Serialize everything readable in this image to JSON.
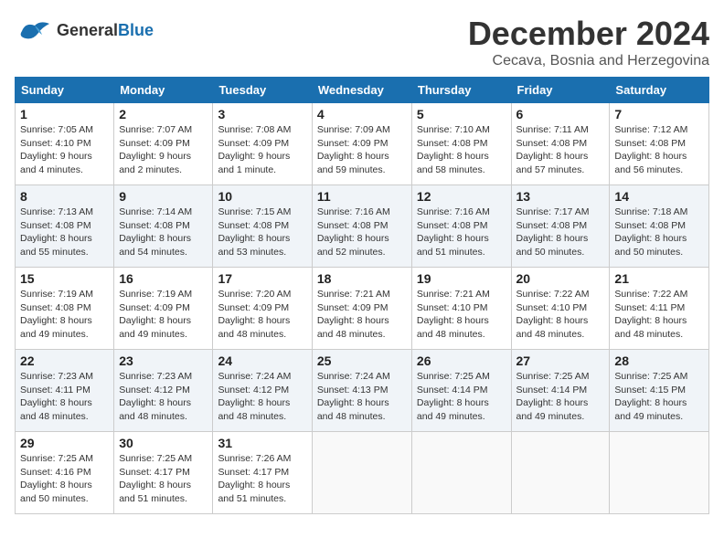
{
  "logo": {
    "general": "General",
    "blue": "Blue"
  },
  "title": "December 2024",
  "subtitle": "Cecava, Bosnia and Herzegovina",
  "headers": [
    "Sunday",
    "Monday",
    "Tuesday",
    "Wednesday",
    "Thursday",
    "Friday",
    "Saturday"
  ],
  "weeks": [
    [
      {
        "day": "1",
        "sunrise": "7:05 AM",
        "sunset": "4:10 PM",
        "daylight": "9 hours and 4 minutes."
      },
      {
        "day": "2",
        "sunrise": "7:07 AM",
        "sunset": "4:09 PM",
        "daylight": "9 hours and 2 minutes."
      },
      {
        "day": "3",
        "sunrise": "7:08 AM",
        "sunset": "4:09 PM",
        "daylight": "9 hours and 1 minute."
      },
      {
        "day": "4",
        "sunrise": "7:09 AM",
        "sunset": "4:09 PM",
        "daylight": "8 hours and 59 minutes."
      },
      {
        "day": "5",
        "sunrise": "7:10 AM",
        "sunset": "4:08 PM",
        "daylight": "8 hours and 58 minutes."
      },
      {
        "day": "6",
        "sunrise": "7:11 AM",
        "sunset": "4:08 PM",
        "daylight": "8 hours and 57 minutes."
      },
      {
        "day": "7",
        "sunrise": "7:12 AM",
        "sunset": "4:08 PM",
        "daylight": "8 hours and 56 minutes."
      }
    ],
    [
      {
        "day": "8",
        "sunrise": "7:13 AM",
        "sunset": "4:08 PM",
        "daylight": "8 hours and 55 minutes."
      },
      {
        "day": "9",
        "sunrise": "7:14 AM",
        "sunset": "4:08 PM",
        "daylight": "8 hours and 54 minutes."
      },
      {
        "day": "10",
        "sunrise": "7:15 AM",
        "sunset": "4:08 PM",
        "daylight": "8 hours and 53 minutes."
      },
      {
        "day": "11",
        "sunrise": "7:16 AM",
        "sunset": "4:08 PM",
        "daylight": "8 hours and 52 minutes."
      },
      {
        "day": "12",
        "sunrise": "7:16 AM",
        "sunset": "4:08 PM",
        "daylight": "8 hours and 51 minutes."
      },
      {
        "day": "13",
        "sunrise": "7:17 AM",
        "sunset": "4:08 PM",
        "daylight": "8 hours and 50 minutes."
      },
      {
        "day": "14",
        "sunrise": "7:18 AM",
        "sunset": "4:08 PM",
        "daylight": "8 hours and 50 minutes."
      }
    ],
    [
      {
        "day": "15",
        "sunrise": "7:19 AM",
        "sunset": "4:08 PM",
        "daylight": "8 hours and 49 minutes."
      },
      {
        "day": "16",
        "sunrise": "7:19 AM",
        "sunset": "4:09 PM",
        "daylight": "8 hours and 49 minutes."
      },
      {
        "day": "17",
        "sunrise": "7:20 AM",
        "sunset": "4:09 PM",
        "daylight": "8 hours and 48 minutes."
      },
      {
        "day": "18",
        "sunrise": "7:21 AM",
        "sunset": "4:09 PM",
        "daylight": "8 hours and 48 minutes."
      },
      {
        "day": "19",
        "sunrise": "7:21 AM",
        "sunset": "4:10 PM",
        "daylight": "8 hours and 48 minutes."
      },
      {
        "day": "20",
        "sunrise": "7:22 AM",
        "sunset": "4:10 PM",
        "daylight": "8 hours and 48 minutes."
      },
      {
        "day": "21",
        "sunrise": "7:22 AM",
        "sunset": "4:11 PM",
        "daylight": "8 hours and 48 minutes."
      }
    ],
    [
      {
        "day": "22",
        "sunrise": "7:23 AM",
        "sunset": "4:11 PM",
        "daylight": "8 hours and 48 minutes."
      },
      {
        "day": "23",
        "sunrise": "7:23 AM",
        "sunset": "4:12 PM",
        "daylight": "8 hours and 48 minutes."
      },
      {
        "day": "24",
        "sunrise": "7:24 AM",
        "sunset": "4:12 PM",
        "daylight": "8 hours and 48 minutes."
      },
      {
        "day": "25",
        "sunrise": "7:24 AM",
        "sunset": "4:13 PM",
        "daylight": "8 hours and 48 minutes."
      },
      {
        "day": "26",
        "sunrise": "7:25 AM",
        "sunset": "4:14 PM",
        "daylight": "8 hours and 49 minutes."
      },
      {
        "day": "27",
        "sunrise": "7:25 AM",
        "sunset": "4:14 PM",
        "daylight": "8 hours and 49 minutes."
      },
      {
        "day": "28",
        "sunrise": "7:25 AM",
        "sunset": "4:15 PM",
        "daylight": "8 hours and 49 minutes."
      }
    ],
    [
      {
        "day": "29",
        "sunrise": "7:25 AM",
        "sunset": "4:16 PM",
        "daylight": "8 hours and 50 minutes."
      },
      {
        "day": "30",
        "sunrise": "7:25 AM",
        "sunset": "4:17 PM",
        "daylight": "8 hours and 51 minutes."
      },
      {
        "day": "31",
        "sunrise": "7:26 AM",
        "sunset": "4:17 PM",
        "daylight": "8 hours and 51 minutes."
      },
      null,
      null,
      null,
      null
    ]
  ],
  "labels": {
    "sunrise": "Sunrise:",
    "sunset": "Sunset:",
    "daylight": "Daylight:"
  }
}
